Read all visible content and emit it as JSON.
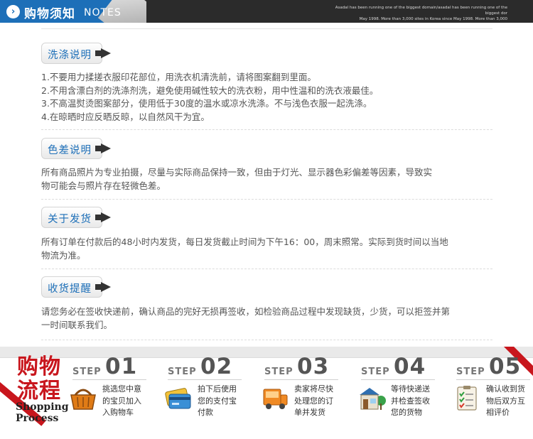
{
  "header": {
    "icon": "chevron-right-icon",
    "title": "购物须知",
    "title_en": "NOTES",
    "tagline_1": "Asadal has been running one of the biggest domain/asadal has been running one of the biggest dor",
    "tagline_2": "May 1998. More than 3,000 sites in Korea since May 1998. More than 3,000"
  },
  "sections": [
    {
      "label": "洗涤说明",
      "lines": [
        "1.不要用力揉搓衣服印花部位，用洗衣机清洗前，请将图案翻到里面。",
        "2.不用含漂白剂的洗涤剂洗，避免使用碱性较大的洗衣粉，用中性温和的洗衣液最佳。",
        "3.不高温熨烫图案部分，使用低于30度的温水或凉水洗涤。不与浅色衣服一起洗涤。",
        "4.在晾晒时应反晒反晾，以自然风干为宜。"
      ]
    },
    {
      "label": "色差说明",
      "lines": [
        "所有商品照片为专业拍摄，尽量与实际商品保持一致，但由于灯光、显示器色彩偏差等因素，导致实",
        "物可能会与照片存在轻微色差。"
      ]
    },
    {
      "label": "关于发货",
      "lines": [
        "所有订单在付款后的48小时内发货，每日发货截止时间为下午16：00，周末照常。实际到货时间以当地",
        "物流为准。"
      ]
    },
    {
      "label": "收货提醒",
      "lines": [
        "请您务必在签收快递前，确认商品的完好无损再签收，如检验商品过程中发现缺货，少货，可以拒签并第",
        "一时间联系我们。"
      ]
    }
  ],
  "process": {
    "title_cn_1": "购物",
    "title_cn_2": "流程",
    "title_en_1": "Shopping",
    "title_en_2": "Process",
    "steps": [
      {
        "word": "STEP",
        "num": "01",
        "icon": "shopping-basket-icon",
        "lines": [
          "挑选您中意",
          "的宝贝加入",
          "入购物车"
        ]
      },
      {
        "word": "STEP",
        "num": "02",
        "icon": "credit-card-icon",
        "lines": [
          "拍下后使用",
          "您的支付宝",
          "付款"
        ]
      },
      {
        "word": "STEP",
        "num": "03",
        "icon": "delivery-truck-icon",
        "lines": [
          "卖家将尽快",
          "处理您的订",
          "单并发货"
        ]
      },
      {
        "word": "STEP",
        "num": "04",
        "icon": "shop-icon",
        "lines": [
          "等待快递送",
          "并检查签收",
          "您的货物"
        ]
      },
      {
        "word": "STEP",
        "num": "05",
        "icon": "checklist-icon",
        "lines": [
          "确认收到货",
          "物后双方互",
          "相评价"
        ]
      }
    ]
  },
  "colors": {
    "accent_blue": "#1d6fb8",
    "accent_red": "#c8161d",
    "header_dark": "#2b2b2b"
  }
}
